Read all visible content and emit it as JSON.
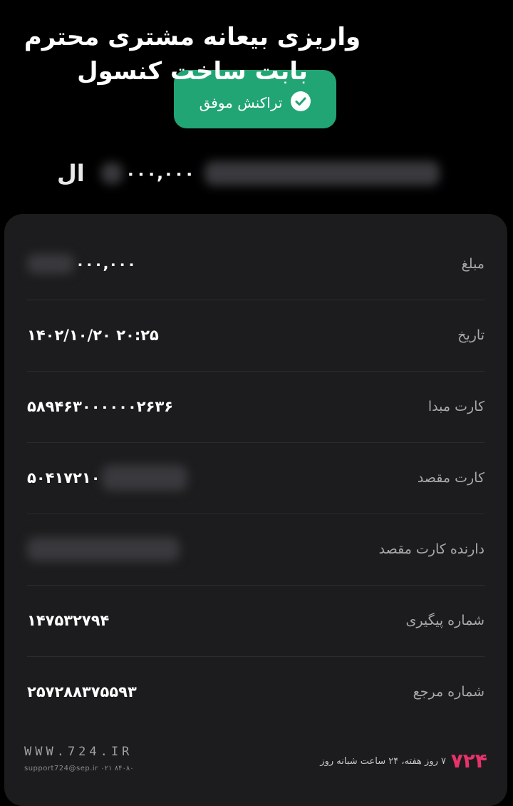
{
  "caption": {
    "line1": "واریزی بیعانه  مشتری محترم",
    "line2": "بابت ساخت کنسول"
  },
  "status": {
    "label": "تراکنش موفق",
    "icon": "check-badge-icon",
    "color": "#21a574"
  },
  "amount": {
    "digits": "۰۰۰,۰۰۰",
    "currency_visible": "ال"
  },
  "details": [
    {
      "label": "مبلغ",
      "value": "۰۰۰,۰۰۰"
    },
    {
      "label": "تاریخ",
      "value": "۱۴۰۲/۱۰/۲۰  ۲۰:۲۵"
    },
    {
      "label": "کارت مبدا",
      "value": "۵۸۹۴۶۳۰۰۰۰۰۰۲۶۳۶"
    },
    {
      "label": "کارت مقصد",
      "value": "۵۰۴۱۷۲۱۰"
    },
    {
      "label": "دارنده کارت مقصد",
      "value": ""
    },
    {
      "label": "شماره پیگیری",
      "value": "۱۴۷۵۳۲۷۹۴"
    },
    {
      "label": "شماره مرجع",
      "value": "۲۵۷۲۸۸۳۷۵۵۹۳"
    }
  ],
  "footer": {
    "website": "WWW.724.IR",
    "support": "support724@sep.ir  ۰۲۱ ۸۴۰۸۰",
    "hours": "۷ روز هفته، ۲۴ ساعت شبانه روز",
    "logo": "۷۲۴"
  }
}
